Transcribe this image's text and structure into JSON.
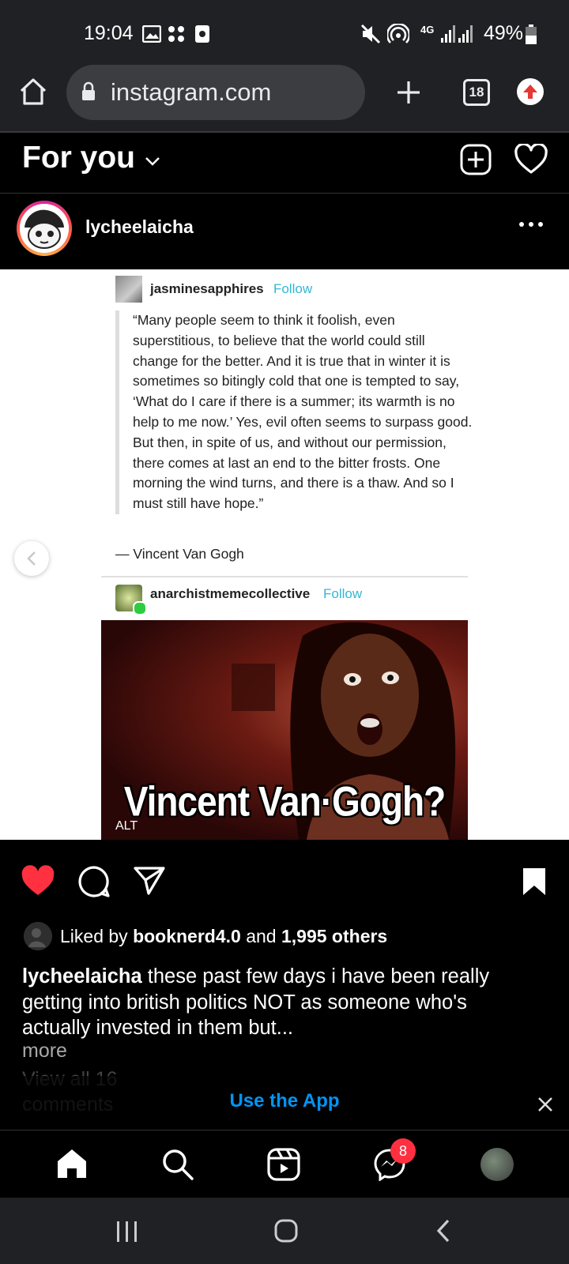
{
  "status_bar": {
    "time": "19:04",
    "network": "4G",
    "battery": "49%"
  },
  "browser": {
    "url": "instagram.com",
    "tab_count": "18"
  },
  "feed_header": {
    "title": "For you"
  },
  "post": {
    "username": "lycheelaicha",
    "tumblr": {
      "first_user": "jasminesapphires",
      "follow_label": "Follow",
      "quote": "“Many people seem to think it foolish, even superstitious, to believe that the world could still change for the better. And it is true that in winter it is sometimes so bitingly cold that one is tempted to say, ‘What do I care if there is a summer; its warmth is no help to me now.’ Yes, evil often seems to surpass good. But then, in spite of us, and without our permission, there comes at last an end to the bitter frosts. One morning the wind turns, and there is a thaw. And so I must still have hope.”",
      "attribution": "— Vincent Van Gogh",
      "second_user": "anarchistmemecollective",
      "gif_caption": "Vincent Van·Gogh?",
      "alt_label": "ALT"
    },
    "likes": {
      "prefix": "Liked by",
      "user": "booknerd4.0",
      "conj": "and",
      "others": "1,995 others"
    },
    "caption_text": " these past few days i have been really getting into british politics NOT as someone who's actually invested in them but...",
    "more_label": "more",
    "view_all": "View all 16 comments"
  },
  "banner": {
    "use_app": "Use the App"
  },
  "bottom_nav": {
    "messages_badge": "8"
  },
  "colors": {
    "accent_blue": "#0095f6",
    "like_red": "#ff3040",
    "tumblr_follow": "#34b7d4"
  }
}
